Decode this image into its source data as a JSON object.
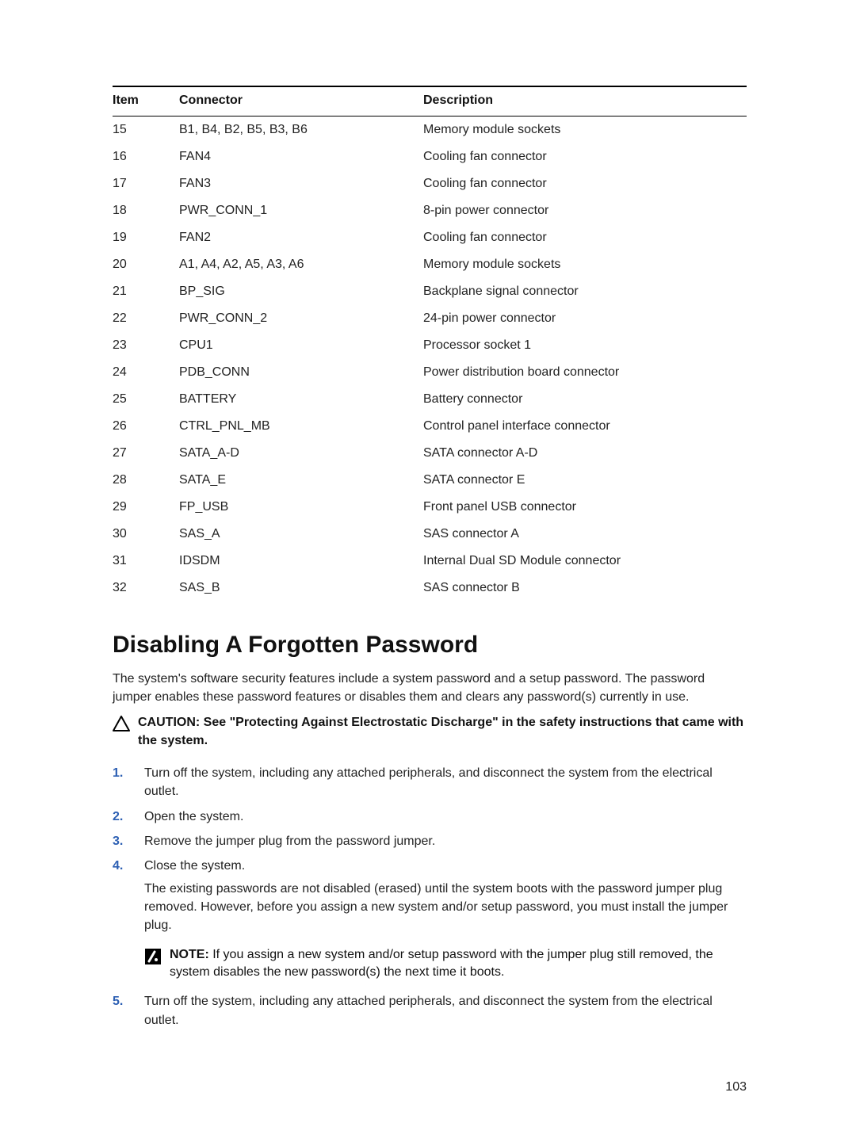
{
  "table": {
    "headers": {
      "item": "Item",
      "connector": "Connector",
      "description": "Description"
    },
    "rows": [
      {
        "item": "15",
        "connector": "B1, B4, B2, B5, B3, B6",
        "description": "Memory module sockets"
      },
      {
        "item": "16",
        "connector": "FAN4",
        "description": "Cooling fan connector"
      },
      {
        "item": "17",
        "connector": "FAN3",
        "description": "Cooling fan connector"
      },
      {
        "item": "18",
        "connector": "PWR_CONN_1",
        "description": "8-pin power connector"
      },
      {
        "item": "19",
        "connector": "FAN2",
        "description": "Cooling fan connector"
      },
      {
        "item": "20",
        "connector": "A1, A4, A2, A5, A3, A6",
        "description": "Memory module sockets"
      },
      {
        "item": "21",
        "connector": "BP_SIG",
        "description": "Backplane signal connector"
      },
      {
        "item": "22",
        "connector": "PWR_CONN_2",
        "description": "24-pin power connector"
      },
      {
        "item": "23",
        "connector": "CPU1",
        "description": "Processor socket 1"
      },
      {
        "item": "24",
        "connector": "PDB_CONN",
        "description": "Power distribution board connector"
      },
      {
        "item": "25",
        "connector": "BATTERY",
        "description": "Battery connector"
      },
      {
        "item": "26",
        "connector": "CTRL_PNL_MB",
        "description": "Control panel interface connector"
      },
      {
        "item": "27",
        "connector": "SATA_A-D",
        "description": "SATA connector A-D"
      },
      {
        "item": "28",
        "connector": "SATA_E",
        "description": "SATA connector E"
      },
      {
        "item": "29",
        "connector": "FP_USB",
        "description": "Front panel USB connector"
      },
      {
        "item": "30",
        "connector": "SAS_A",
        "description": "SAS connector A"
      },
      {
        "item": "31",
        "connector": "IDSDM",
        "description": "Internal Dual SD Module connector"
      },
      {
        "item": "32",
        "connector": "SAS_B",
        "description": "SAS connector B"
      }
    ]
  },
  "section": {
    "title": "Disabling A Forgotten Password",
    "intro": "The system's software security features include a system password and a setup password. The password jumper enables these password features or disables them and clears any password(s) currently in use.",
    "caution": {
      "label": "CAUTION: ",
      "text": "See \"Protecting Against Electrostatic Discharge\" in the safety instructions that came with the system."
    },
    "steps": [
      {
        "n": "1.",
        "text": "Turn off the system, including any attached peripherals, and disconnect the system from the electrical outlet."
      },
      {
        "n": "2.",
        "text": "Open the system."
      },
      {
        "n": "3.",
        "text": "Remove the jumper plug from the password jumper."
      },
      {
        "n": "4.",
        "text": "Close the system.",
        "sub": "The existing passwords are not disabled (erased) until the system boots with the password jumper plug removed. However, before you assign a new system and/or setup password, you must install the jumper plug.",
        "note": {
          "label": "NOTE: ",
          "text": "If you assign a new system and/or setup password with the jumper plug still removed, the system disables the new password(s) the next time it boots."
        }
      },
      {
        "n": "5.",
        "text": "Turn off the system, including any attached peripherals, and disconnect the system from the electrical outlet."
      }
    ]
  },
  "pageNumber": "103"
}
